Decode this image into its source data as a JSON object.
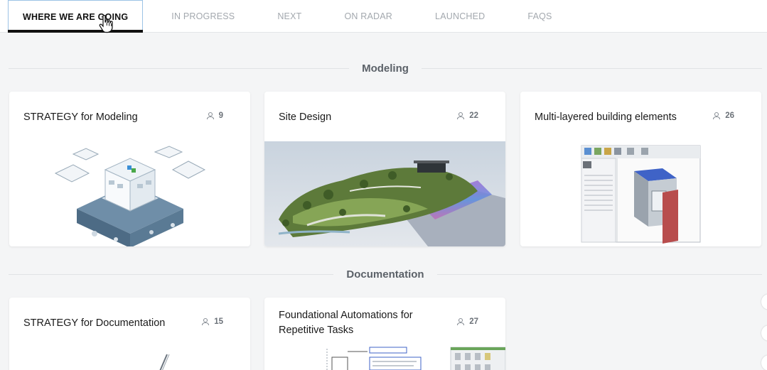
{
  "tabs": [
    {
      "label": "WHERE WE ARE GOING",
      "active": true
    },
    {
      "label": "IN PROGRESS",
      "active": false
    },
    {
      "label": "NEXT",
      "active": false
    },
    {
      "label": "ON RADAR",
      "active": false
    },
    {
      "label": "LAUNCHED",
      "active": false
    },
    {
      "label": "FAQS",
      "active": false
    }
  ],
  "sections": [
    {
      "title": "Modeling",
      "cards": [
        {
          "title": "STRATEGY for Modeling",
          "votes": "9",
          "image": "isometric-building-illustration"
        },
        {
          "title": "Site Design",
          "votes": "22",
          "image": "site-design-render"
        },
        {
          "title": "Multi-layered building elements",
          "votes": "26",
          "image": "software-screenshot-wall-layers"
        }
      ]
    },
    {
      "title": "Documentation",
      "cards": [
        {
          "title": "STRATEGY for Documentation",
          "votes": "15",
          "image": "pencil-sketch"
        },
        {
          "title": "Foundational Automations for Repetitive Tasks",
          "votes": "27",
          "image": "annotated-detail-drawing"
        }
      ]
    }
  ],
  "colors": {
    "active_tab_border": "#9cc3e6",
    "active_tab_underline": "#111111",
    "inactive_tab": "#a3a8ae",
    "background": "#f4f5f6"
  },
  "icons": {
    "votes": "person-icon",
    "cursor": "hand-pointer-icon"
  }
}
